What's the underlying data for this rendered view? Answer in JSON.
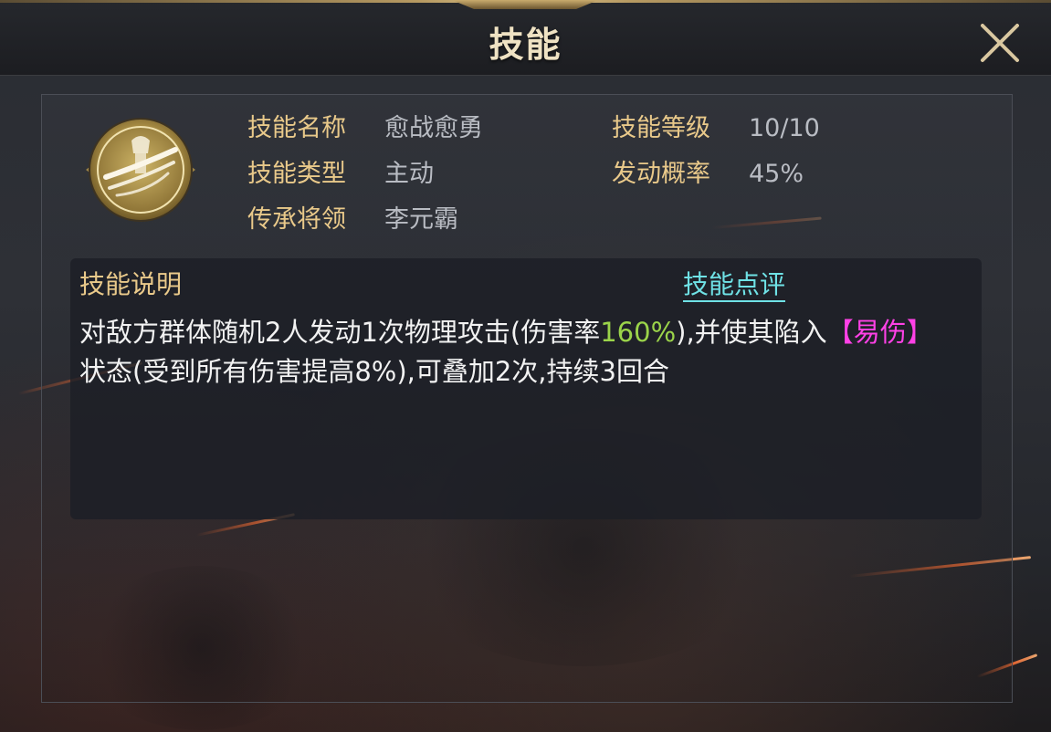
{
  "dialog": {
    "title": "技能",
    "close_icon": "close-icon"
  },
  "skill": {
    "icon": "skill-emblem-icon",
    "name_label": "技能名称",
    "name_value": "愈战愈勇",
    "level_label": "技能等级",
    "level_value": "10/10",
    "type_label": "技能类型",
    "type_value": "主动",
    "chance_label": "发动概率",
    "chance_value": "45%",
    "inherit_label": "传承将领",
    "inherit_value": "李元霸"
  },
  "description": {
    "title": "技能说明",
    "review_link": "技能点评",
    "part1": "对敌方群体随机2人发动1次物理攻击(伤害率",
    "damage_rate": "160%",
    "part2": "),并使其陷入",
    "status_name": "【易伤】",
    "part3": "状态(受到所有伤害提高8%),可叠加2次,持续3回合"
  },
  "colors": {
    "label": "#e9c98a",
    "value": "#b9bcc3",
    "highlight_rate": "#9bd44a",
    "highlight_status": "#ff41e6",
    "link": "#6fe2e6"
  }
}
